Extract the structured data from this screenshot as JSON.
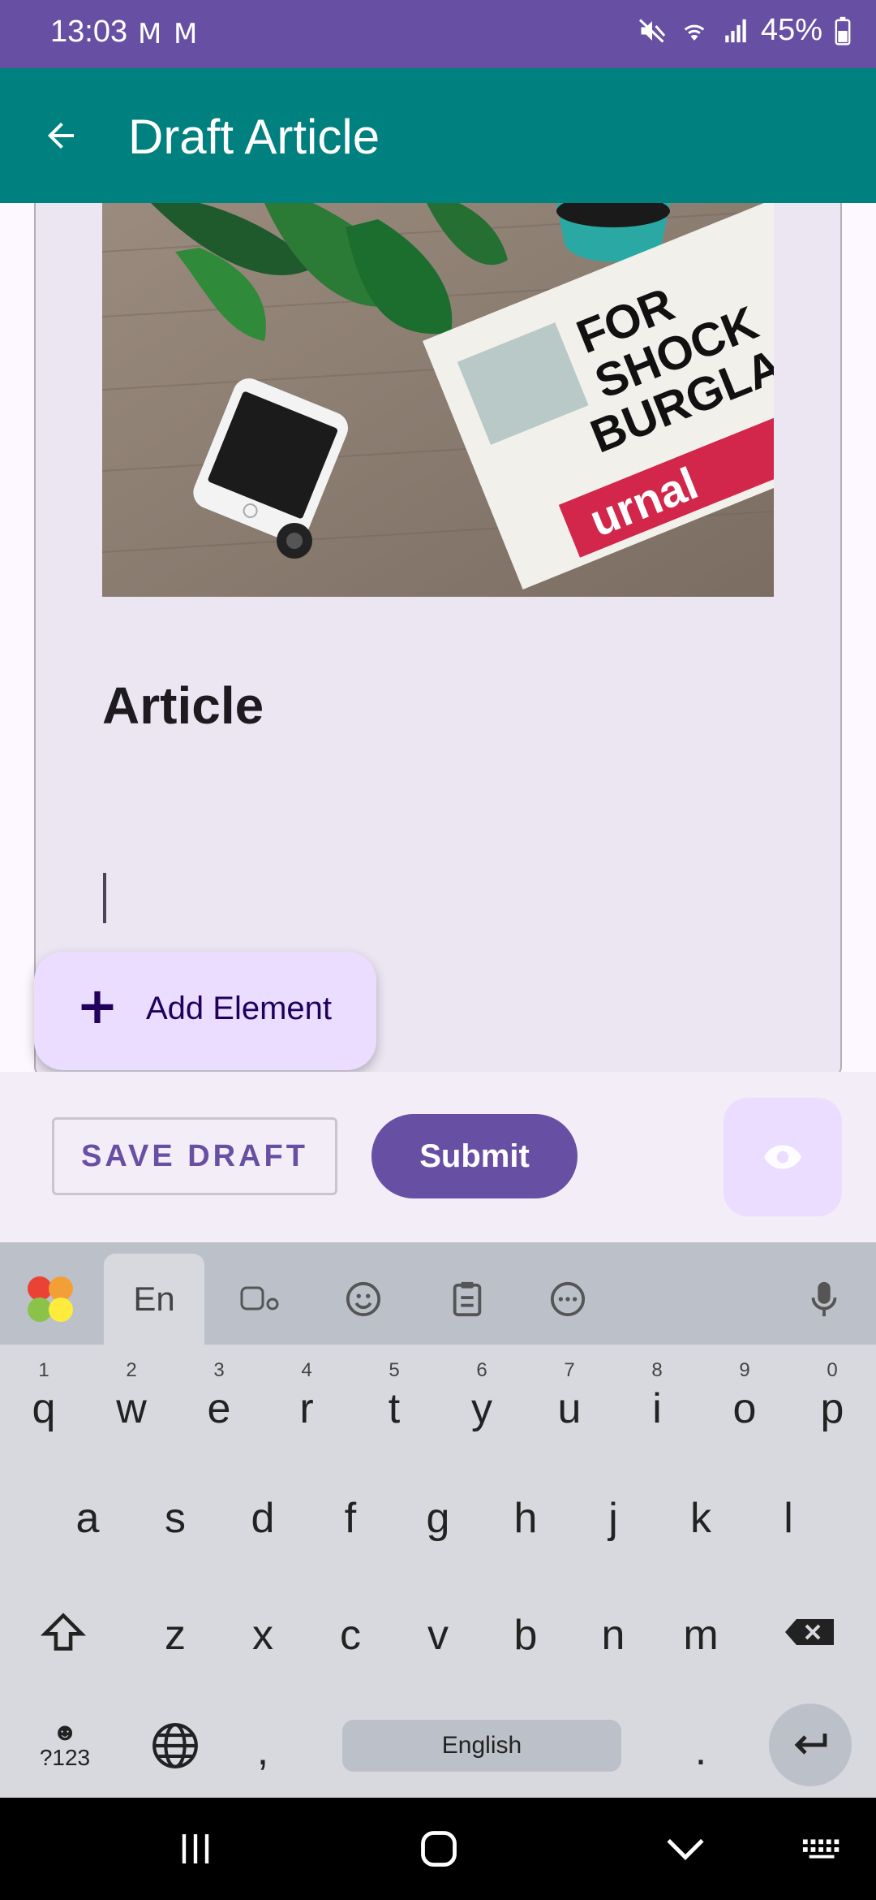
{
  "status_bar": {
    "time": "13:03",
    "mail_icons": [
      "M",
      "M"
    ],
    "battery": "45%"
  },
  "app_bar": {
    "title": "Draft Article",
    "back_icon": "arrow-back-icon"
  },
  "editor": {
    "heading": "Article"
  },
  "fab": {
    "label": "Add Element",
    "icon": "plus-icon"
  },
  "actions": {
    "save_label": "SAVE DRAFT",
    "submit_label": "Submit",
    "preview_icon": "eye-icon"
  },
  "keyboard": {
    "lang_tab": "En",
    "row1": [
      {
        "c": "q",
        "n": "1"
      },
      {
        "c": "w",
        "n": "2"
      },
      {
        "c": "e",
        "n": "3"
      },
      {
        "c": "r",
        "n": "4"
      },
      {
        "c": "t",
        "n": "5"
      },
      {
        "c": "y",
        "n": "6"
      },
      {
        "c": "u",
        "n": "7"
      },
      {
        "c": "i",
        "n": "8"
      },
      {
        "c": "o",
        "n": "9"
      },
      {
        "c": "p",
        "n": "0"
      }
    ],
    "row2": [
      "a",
      "s",
      "d",
      "f",
      "g",
      "h",
      "j",
      "k",
      "l"
    ],
    "row3": [
      "z",
      "x",
      "c",
      "v",
      "b",
      "n",
      "m"
    ],
    "sym_label": "?123",
    "comma": ",",
    "period": ".",
    "space_label": "English"
  },
  "colors": {
    "status_bar": "#6750a4",
    "app_bar": "#00807f",
    "primary": "#6750a4",
    "fab_bg": "#eaddff",
    "card_bg": "#ece6f3"
  }
}
